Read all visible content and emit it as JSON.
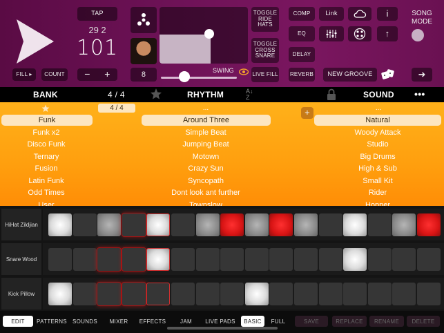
{
  "top": {
    "tap_label": "TAP",
    "tempo_fraction": "29 2",
    "tempo_value": "101",
    "fill_label": "FILL ▸",
    "count_label": "COUNT",
    "minus_label": "−",
    "plus_label": "+",
    "steps_value": "8",
    "swing_label": "SWING",
    "toggle_ride_hats": "TOGGLE RIDE HATS",
    "toggle_cross_snare": "TOGGLE CROSS SNARE",
    "live_fill": "LIVE FILL",
    "comp": "COMP",
    "link": "Link",
    "info": "i",
    "eq": "EQ",
    "delay": "DELAY",
    "reverb": "REVERB",
    "new_groove": "NEW GROOVE",
    "song_mode": "SONG MODE"
  },
  "header": {
    "bank": "BANK",
    "time_sig": "4 / 4",
    "rhythm": "RHYTHM",
    "sound": "SOUND",
    "more": "•••"
  },
  "lists": {
    "bank_items": [
      "Funk",
      "Funk x2",
      "Disco Funk",
      "Ternary",
      "Fusion",
      "Latin Funk",
      "Odd Times",
      "User"
    ],
    "bank_selected": "Funk",
    "time_sig_filter": "4 / 4",
    "rhythm_header": "...",
    "rhythm_items": [
      "Around Three",
      "Simple Beat",
      "Jumping Beat",
      "Motown",
      "Crazy Sun",
      "Syncopath",
      "Dont look ant further",
      "Townslow"
    ],
    "rhythm_selected": "Around Three",
    "sound_header": "...",
    "sound_items": [
      "Natural",
      "Woody Attack",
      "Studio",
      "Big Drums",
      "High & Sub",
      "Small Kit",
      "Rider",
      "Hopper"
    ],
    "sound_selected": "Natural"
  },
  "pads": {
    "rows": [
      {
        "name": "HiHat Zildjian",
        "states": [
          "on",
          "off",
          "mid",
          "off",
          "on",
          "off",
          "mid",
          "red",
          "mid",
          "red",
          "mid",
          "off",
          "on",
          "off",
          "mid",
          "red"
        ]
      },
      {
        "name": "Snare Wood",
        "states": [
          "off",
          "off",
          "off",
          "off",
          "on",
          "off",
          "off",
          "off",
          "off",
          "off",
          "off",
          "off",
          "on",
          "off",
          "off",
          "off"
        ]
      },
      {
        "name": "Kick Pillow",
        "states": [
          "on",
          "off",
          "off",
          "off",
          "off",
          "off",
          "off",
          "off",
          "on",
          "off",
          "off",
          "off",
          "off",
          "off",
          "off",
          "off"
        ]
      }
    ],
    "glow_columns": [
      2,
      3
    ],
    "current_column": 4
  },
  "bottom": {
    "tabs": [
      "EDIT",
      "PATTERNS",
      "SOUNDS",
      "MIXER",
      "EFFECTS",
      "JAM",
      "LIVE PADS",
      "BASIC",
      "FULL",
      "SAVE",
      "REPLACE",
      "RENAME",
      "DELETE"
    ],
    "active": [
      "EDIT",
      "BASIC"
    ],
    "disabled": [
      "SAVE",
      "REPLACE",
      "RENAME",
      "DELETE"
    ]
  },
  "colors": {
    "top_panel": "#6e1257",
    "list_orange": "#ff9f0e",
    "selection": "#fde6c0",
    "pad_red": "#d81414"
  }
}
